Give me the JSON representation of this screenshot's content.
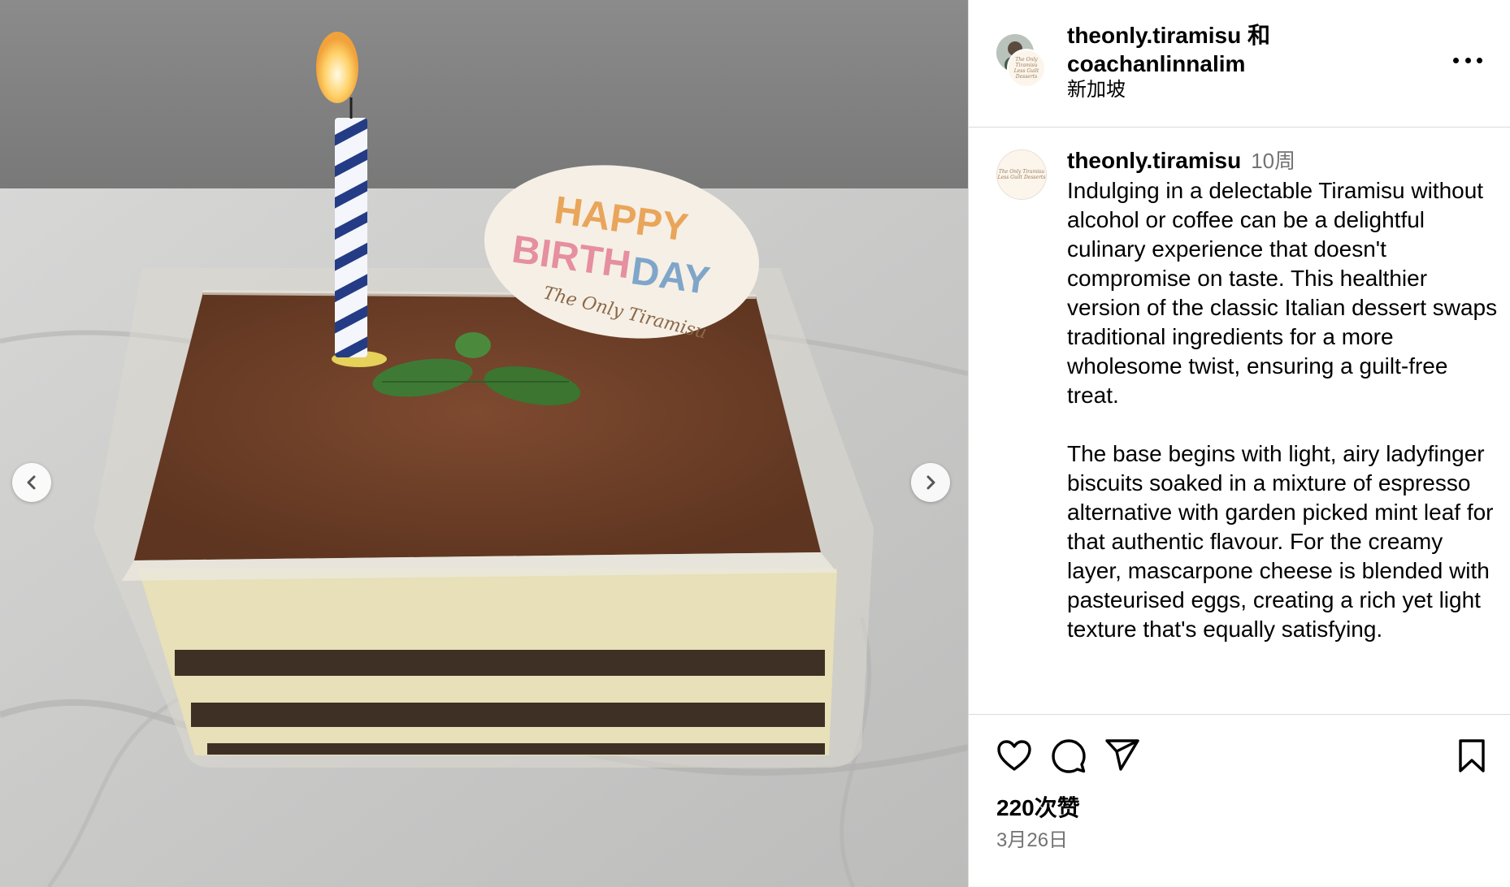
{
  "post": {
    "image_alt": "Tiramisu in a plastic container with a lit birthday candle, mint leaf and a Happy Birthday topper",
    "topper": {
      "line1": "HAPPY",
      "line2a": "BIRTH",
      "line2b": "DAY",
      "line3": "The Only Tiramisu"
    },
    "logo_text": {
      "line1": "The Only Tiramisu",
      "line2": "Less Guilt Desserts"
    }
  },
  "header": {
    "names": "theonly.tiramisu 和 coachanlinnalim",
    "location": "新加坡"
  },
  "caption": {
    "username": "theonly.tiramisu",
    "time": "10周",
    "text": "Indulging in a delectable Tiramisu without alcohol or coffee can be a delightful culinary experience that doesn't compromise on taste. This healthier version of the classic Italian dessert swaps traditional ingredients for a more wholesome twist, ensuring a guilt-free treat.\n\nThe base begins with light, airy ladyfinger biscuits soaked in a mixture of espresso alternative with garden picked mint leaf for that authentic flavour. For the creamy layer, mascarpone cheese is blended with pasteurised eggs, creating a rich yet light texture that's equally satisfying."
  },
  "footer": {
    "likes": "220次赞",
    "date": "3月26日"
  },
  "icons": {
    "like": "heart-icon",
    "comment": "comment-icon",
    "share": "send-icon",
    "save": "bookmark-icon",
    "more": "more-icon",
    "prev": "chevron-left-icon",
    "next": "chevron-right-icon"
  }
}
